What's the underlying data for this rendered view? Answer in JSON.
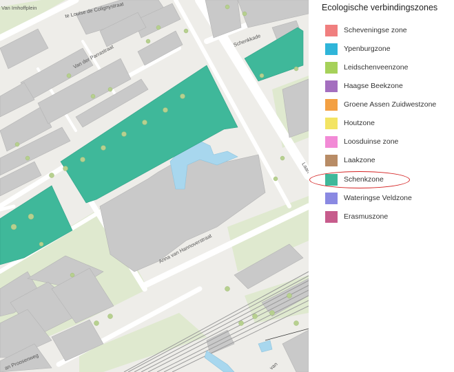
{
  "legend": {
    "title": "Ecologische verbindingszones",
    "items": [
      {
        "name": "scheveningse",
        "label": "Scheveningse zone",
        "color": "#f07f7f"
      },
      {
        "name": "ypenburg",
        "label": "Ypenburgzone",
        "color": "#2fb5d9"
      },
      {
        "name": "leidschenveen",
        "label": "Leidschenveenzone",
        "color": "#a6d15a"
      },
      {
        "name": "haagse-beek",
        "label": "Haagse Beekzone",
        "color": "#a46fbf"
      },
      {
        "name": "groene-assen",
        "label": "Groene Assen Zuidwestzone",
        "color": "#f3a043"
      },
      {
        "name": "houtzone",
        "label": "Houtzone",
        "color": "#f3e463"
      },
      {
        "name": "loosduinse",
        "label": "Loosduinse zone",
        "color": "#f28ad6"
      },
      {
        "name": "laak",
        "label": "Laakzone",
        "color": "#b88c66"
      },
      {
        "name": "schenk",
        "label": "Schenkzone",
        "color": "#3fb89a"
      },
      {
        "name": "wateringse-veld",
        "label": "Wateringse Veldzone",
        "color": "#8a89e2"
      },
      {
        "name": "erasmus",
        "label": "Erasmuszone",
        "color": "#c75c8c"
      }
    ],
    "highlighted_item": "Schenkzone",
    "highlight_color": "#d42020"
  },
  "map": {
    "streets": {
      "street_1": "Van Imhoffplein",
      "street_2": "te Louise de Colignystraat",
      "street_3": "Van der Parrastraat",
      "street_4": "Schenkkade",
      "street_5": "Anna van Hannoverstraat",
      "street_6": "an Proosenweg",
      "street_7": "Laan",
      "street_8": "van"
    },
    "colors": {
      "background": "#eeede9",
      "building": "#c9c9c9",
      "green": "#dfe9cf",
      "zone": "#3fb89a",
      "water": "#a8d7ee",
      "rail": "#9a9a9a"
    }
  }
}
